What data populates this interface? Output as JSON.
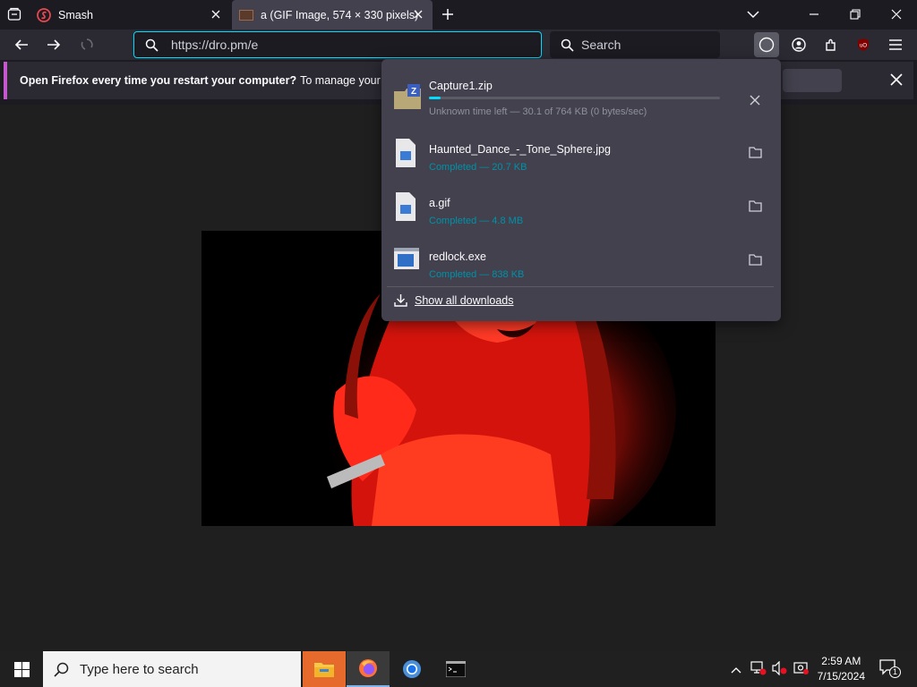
{
  "tabs": [
    {
      "title": "Smash"
    },
    {
      "title": "a (GIF Image, 574 × 330 pixels)"
    }
  ],
  "navbar": {
    "url": "https://dro.pm/e",
    "search_placeholder": "Search"
  },
  "notification": {
    "bold": "Open Firefox every time you restart your computer?",
    "text": "To manage your Start"
  },
  "downloads": {
    "items": [
      {
        "name": "Capture1.zip",
        "status": "Unknown time left — 30.1 of 764 KB (0 bytes/sec)",
        "progress": 0.04,
        "state": "in-progress",
        "icon": "zip-icon"
      },
      {
        "name": "Haunted_Dance_-_Tone_Sphere.jpg",
        "status": "Completed — 20.7 KB",
        "state": "done",
        "icon": "image-file-icon"
      },
      {
        "name": "a.gif",
        "status": "Completed — 4.8 MB",
        "state": "done",
        "icon": "image-file-icon"
      },
      {
        "name": "redlock.exe",
        "status": "Completed — 838 KB",
        "state": "done",
        "icon": "exe-file-icon"
      }
    ],
    "show_all": "Show all downloads"
  },
  "taskbar": {
    "search_placeholder": "Type here to search",
    "time": "2:59 AM",
    "date": "7/15/2024",
    "notification_count": "1"
  }
}
